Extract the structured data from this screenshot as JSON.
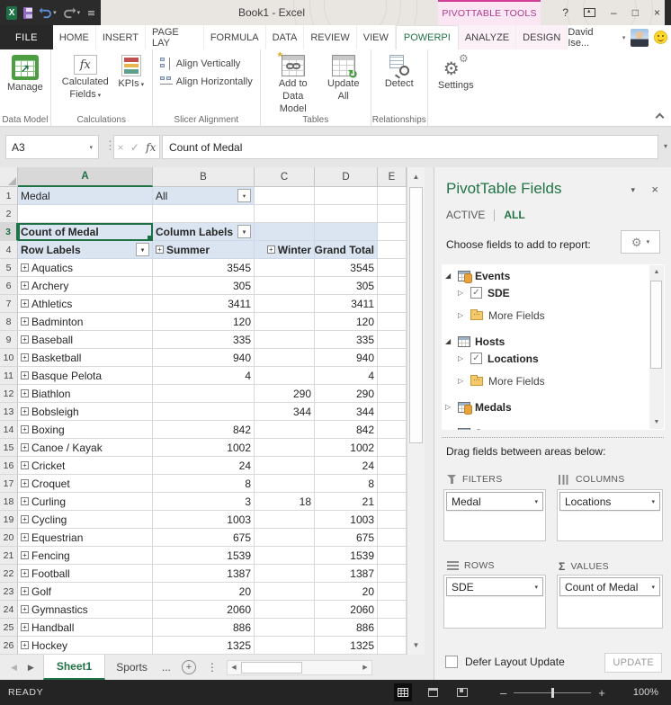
{
  "title_bar": {
    "title": "Book1 - Excel",
    "tools_label": "PIVOTTABLE TOOLS",
    "help": "?"
  },
  "tabs": {
    "file": "FILE",
    "items": [
      "HOME",
      "INSERT",
      "PAGE LAY",
      "FORMULA",
      "DATA",
      "REVIEW",
      "VIEW"
    ],
    "powerpivot": "POWERPI",
    "contextual": [
      "ANALYZE",
      "DESIGN"
    ],
    "user_name": "David Ise..."
  },
  "ribbon": {
    "groups": {
      "data_model": {
        "label": "Data Model",
        "manage": "Manage"
      },
      "calculations": {
        "label": "Calculations",
        "calculated_fields": "Calculated Fields",
        "kpis": "KPIs"
      },
      "slicer_alignment": {
        "label": "Slicer Alignment",
        "align_vertically": "Align Vertically",
        "align_horizontally": "Align Horizontally"
      },
      "tables": {
        "label": "Tables",
        "add_to_data_model": "Add to Data Model",
        "update_all": "Update All"
      },
      "relationships": {
        "label": "Relationships",
        "detect": "Detect"
      },
      "settings": {
        "settings": "Settings"
      }
    }
  },
  "formula_bar": {
    "name_box": "A3",
    "formula": "Count of Medal"
  },
  "grid": {
    "columns": [
      "A",
      "B",
      "C",
      "D",
      "E"
    ],
    "selected_column": "A",
    "selected_row": 3,
    "filter_row": {
      "label": "Medal",
      "value": "All"
    },
    "header_rows": {
      "pivot_title": "Count of Medal",
      "column_labels": "Column Labels",
      "row_labels": "Row Labels",
      "summer": "Summer",
      "winter": "Winter",
      "grand_total": "Grand Total"
    },
    "data_rows": [
      {
        "name": "Aquatics",
        "summer": 3545,
        "winter": null,
        "total": 3545
      },
      {
        "name": "Archery",
        "summer": 305,
        "winter": null,
        "total": 305
      },
      {
        "name": "Athletics",
        "summer": 3411,
        "winter": null,
        "total": 3411
      },
      {
        "name": "Badminton",
        "summer": 120,
        "winter": null,
        "total": 120
      },
      {
        "name": "Baseball",
        "summer": 335,
        "winter": null,
        "total": 335
      },
      {
        "name": "Basketball",
        "summer": 940,
        "winter": null,
        "total": 940
      },
      {
        "name": "Basque Pelota",
        "summer": 4,
        "winter": null,
        "total": 4
      },
      {
        "name": "Biathlon",
        "summer": null,
        "winter": 290,
        "total": 290
      },
      {
        "name": "Bobsleigh",
        "summer": null,
        "winter": 344,
        "total": 344
      },
      {
        "name": "Boxing",
        "summer": 842,
        "winter": null,
        "total": 842
      },
      {
        "name": "Canoe / Kayak",
        "summer": 1002,
        "winter": null,
        "total": 1002
      },
      {
        "name": "Cricket",
        "summer": 24,
        "winter": null,
        "total": 24
      },
      {
        "name": "Croquet",
        "summer": 8,
        "winter": null,
        "total": 8
      },
      {
        "name": "Curling",
        "summer": 3,
        "winter": 18,
        "total": 21
      },
      {
        "name": "Cycling",
        "summer": 1003,
        "winter": null,
        "total": 1003
      },
      {
        "name": "Equestrian",
        "summer": 675,
        "winter": null,
        "total": 675
      },
      {
        "name": "Fencing",
        "summer": 1539,
        "winter": null,
        "total": 1539
      },
      {
        "name": "Football",
        "summer": 1387,
        "winter": null,
        "total": 1387
      },
      {
        "name": "Golf",
        "summer": 20,
        "winter": null,
        "total": 20
      },
      {
        "name": "Gymnastics",
        "summer": 2060,
        "winter": null,
        "total": 2060
      },
      {
        "name": "Handball",
        "summer": 886,
        "winter": null,
        "total": 886
      },
      {
        "name": "Hockey",
        "summer": 1325,
        "winter": null,
        "total": 1325
      }
    ]
  },
  "sheet_tabs": {
    "active": "Sheet1",
    "others": [
      "Sports"
    ],
    "overflow": "..."
  },
  "status_bar": {
    "mode": "READY",
    "zoom_level": "100%"
  },
  "fields_pane": {
    "title": "PivotTable Fields",
    "tab_active": "ACTIVE",
    "tab_all": "ALL",
    "selected_tab": "ALL",
    "choose_label": "Choose fields to add to report:",
    "field_list": [
      {
        "label": "Events",
        "icon": "table-db",
        "expanded": true,
        "children": [
          {
            "label": "SDE",
            "kind": "checkbox",
            "checked": true
          },
          {
            "label": "More Fields",
            "kind": "folder"
          }
        ]
      },
      {
        "label": "Hosts",
        "icon": "table",
        "expanded": true,
        "children": [
          {
            "label": "Locations",
            "kind": "checkbox",
            "checked": true
          },
          {
            "label": "More Fields",
            "kind": "folder"
          }
        ]
      },
      {
        "label": "Medals",
        "icon": "table-db",
        "expanded": false,
        "children": []
      },
      {
        "label": "Sports",
        "icon": "table",
        "expanded": false,
        "children": []
      }
    ],
    "drag_label": "Drag fields between areas below:",
    "areas": {
      "filters": {
        "label": "FILTERS",
        "items": [
          "Medal"
        ]
      },
      "columns": {
        "label": "COLUMNS",
        "items": [
          "Locations"
        ]
      },
      "rows": {
        "label": "ROWS",
        "items": [
          "SDE"
        ]
      },
      "values": {
        "label": "VALUES",
        "items": [
          "Count of Medal"
        ]
      }
    },
    "defer_label": "Defer Layout Update",
    "update_label": "UPDATE"
  },
  "icons": {
    "dropdown": "▾",
    "collapsed": "▷",
    "expanded": "◢",
    "check": "✓",
    "close": "×",
    "minimize": "–",
    "maximize": "□",
    "expand_plus": "+",
    "up_arrow": "▲",
    "down_arrow": "▼",
    "left_arrow": "◀",
    "right_arrow": "▶",
    "gear": "⚙",
    "sigma": "Σ",
    "refresh": "↻",
    "undo": "↶",
    "redo": "↷",
    "vertical_dots": "⋮",
    "new_sheet": "+"
  },
  "colors": {
    "accent_green": "#217346",
    "contextual_pink": "#C13C92",
    "pivot_header_blue": "#DBE5F1",
    "dark_frame": "#2B2B2B"
  }
}
